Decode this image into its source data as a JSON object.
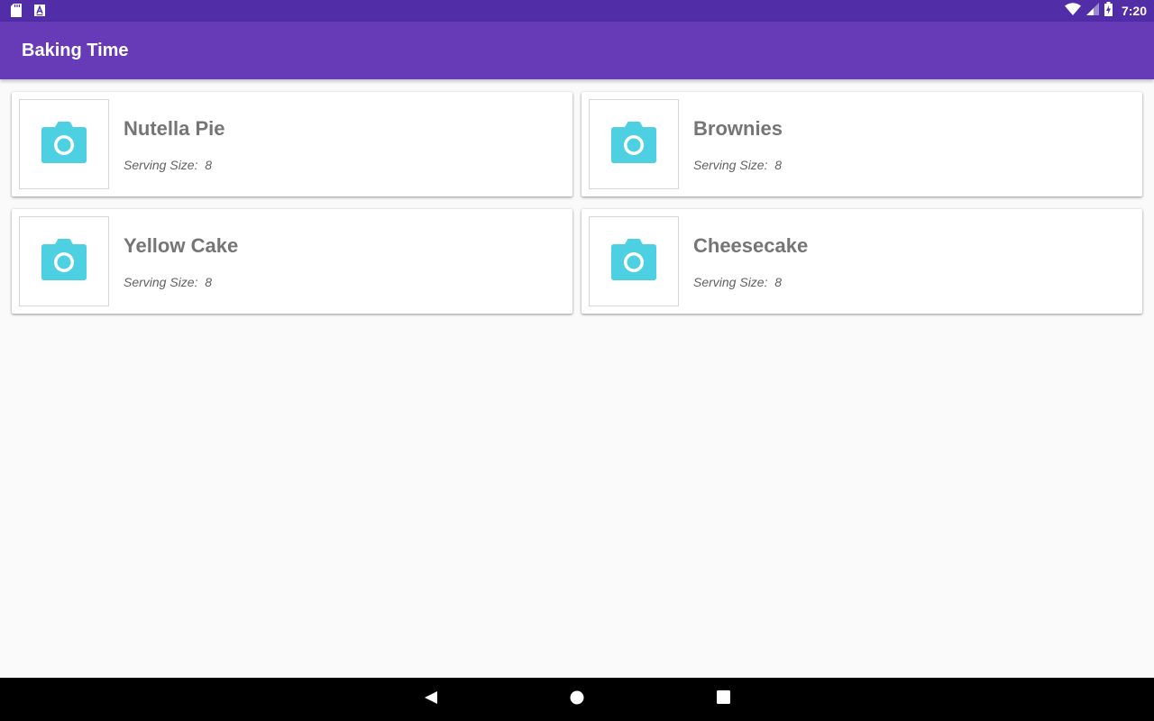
{
  "status_bar": {
    "time": "7:20",
    "icons": [
      "sd-card-icon",
      "text-notification-icon",
      "wifi-icon",
      "cell-signal-icon",
      "battery-charging-icon"
    ]
  },
  "app_bar": {
    "title": "Baking Time",
    "color": "#673ab7",
    "status_color": "#512da8"
  },
  "recipes": [
    {
      "name": "Nutella Pie",
      "serving_label": "Serving Size:",
      "serving_value": "8"
    },
    {
      "name": "Brownies",
      "serving_label": "Serving Size:",
      "serving_value": "8"
    },
    {
      "name": "Yellow Cake",
      "serving_label": "Serving Size:",
      "serving_value": "8"
    },
    {
      "name": "Cheesecake",
      "serving_label": "Serving Size:",
      "serving_value": "8"
    }
  ],
  "colors": {
    "camera_icon": "#4dd0e1",
    "background": "#fafafa"
  },
  "nav_bar": {
    "icons": [
      "back-icon",
      "home-icon",
      "recents-icon"
    ]
  }
}
